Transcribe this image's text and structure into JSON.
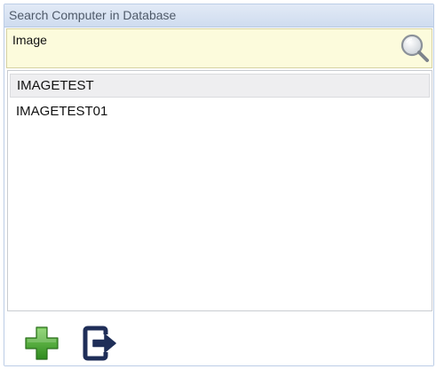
{
  "window": {
    "title": "Search Computer in Database"
  },
  "search": {
    "value": "Image",
    "button_icon": "magnifier-icon"
  },
  "results": [
    {
      "label": "IMAGETEST",
      "selected": true
    },
    {
      "label": "IMAGETEST01",
      "selected": false
    }
  ],
  "toolbar": {
    "add_icon": "plus-icon",
    "exit_icon": "exit-icon"
  },
  "colors": {
    "title_bar": "#cfdcef",
    "search_background": "#fcfbdc",
    "selection": "#eeeef0",
    "add_green": "#44a32c",
    "exit_navy": "#1f2e58"
  }
}
